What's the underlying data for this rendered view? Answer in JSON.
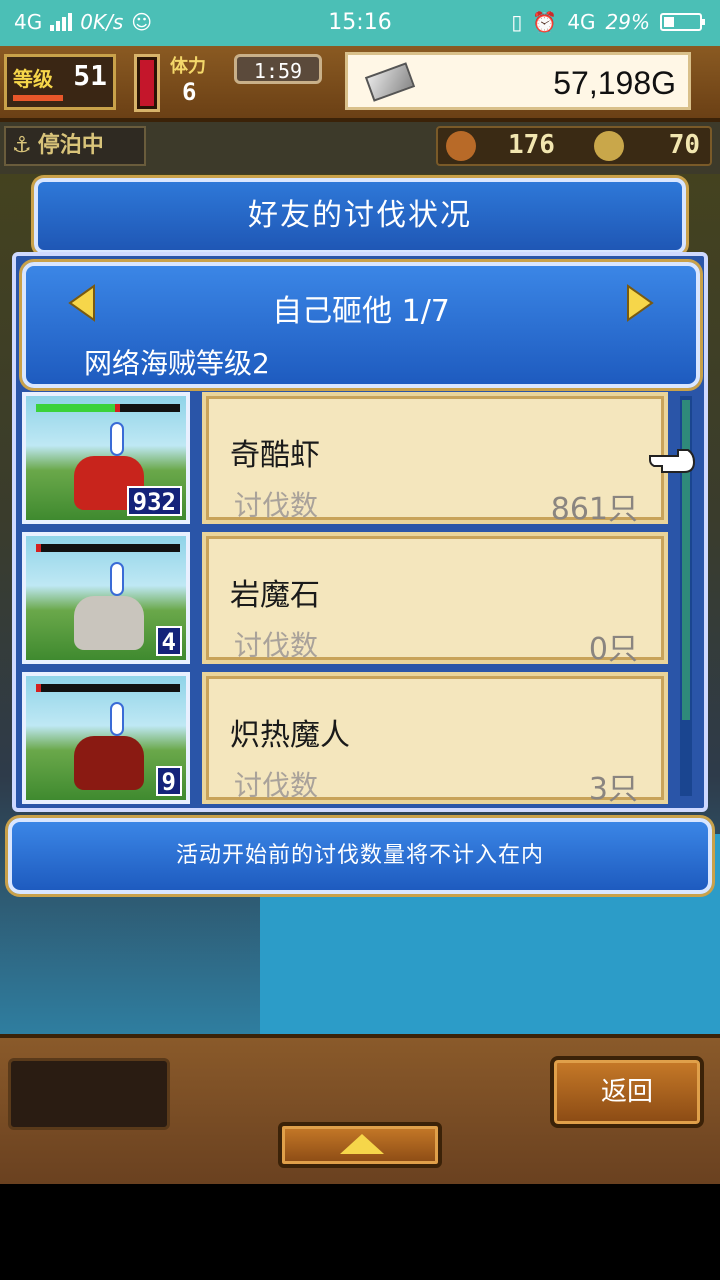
{
  "status_bar": {
    "network_left": "4G",
    "speed": "0K/s",
    "time": "15:16",
    "network_right": "4G",
    "battery": "29%",
    "battery_fraction": 0.29
  },
  "hud": {
    "level_label": "等级",
    "level_value": "51",
    "stamina_label": "体力",
    "stamina_value": "6",
    "timer": "1:59",
    "gold": "57,198G",
    "anchor_status": "停泊中",
    "resource_1": "176",
    "resource_2": "70"
  },
  "modal": {
    "title": "好友的讨伐状况",
    "friend_name": "自己砸他 1/7",
    "pirate_level": "网络海贼等级2",
    "notice": "活动开始前的讨伐数量将不计入在内"
  },
  "monsters": [
    {
      "name": "奇酷虾",
      "label": "讨伐数",
      "value": "861只",
      "count": "932",
      "hp_fraction": 0.55,
      "color": "#c8241c"
    },
    {
      "name": "岩魔石",
      "label": "讨伐数",
      "value": "0只",
      "count": "4",
      "hp_fraction": 0.0,
      "color": "#c9c5bd"
    },
    {
      "name": "炽热魔人",
      "label": "讨伐数",
      "value": "3只",
      "count": "9",
      "hp_fraction": 0.0,
      "color": "#8a1a12"
    }
  ],
  "buttons": {
    "back": "返回"
  },
  "colors": {
    "panel_blue": "#1e5bbf",
    "card_cream": "#f4e6bd",
    "statusbar": "#4bbfb6"
  }
}
